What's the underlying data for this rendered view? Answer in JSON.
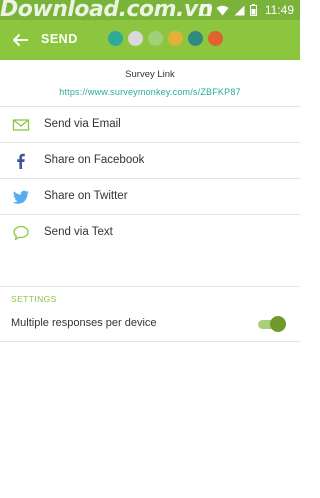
{
  "status_bar": {
    "watermark": "Download.com.vn",
    "time": "11:49"
  },
  "app_bar": {
    "title": "SEND",
    "theme_colors": [
      "#2fa99c",
      "#d9d9d9",
      "#9fd07a",
      "#e3b13a",
      "#2f8b82",
      "#e0622f"
    ]
  },
  "survey": {
    "label": "Survey Link",
    "url": "https://www.surveymonkey.com/s/ZBFKP87"
  },
  "share_options": [
    {
      "label": "Send via Email",
      "icon": "mail-icon"
    },
    {
      "label": "Share on Facebook",
      "icon": "facebook-icon"
    },
    {
      "label": "Share on Twitter",
      "icon": "twitter-icon"
    },
    {
      "label": "Send via Text",
      "icon": "chat-bubble-icon"
    }
  ],
  "settings": {
    "header": "SETTINGS",
    "multiple_responses": {
      "label": "Multiple responses per device",
      "enabled": true
    }
  },
  "colors": {
    "accent": "#8cc63f",
    "link": "#2aa8a0",
    "facebook": "#3b5998",
    "twitter": "#55acee"
  }
}
